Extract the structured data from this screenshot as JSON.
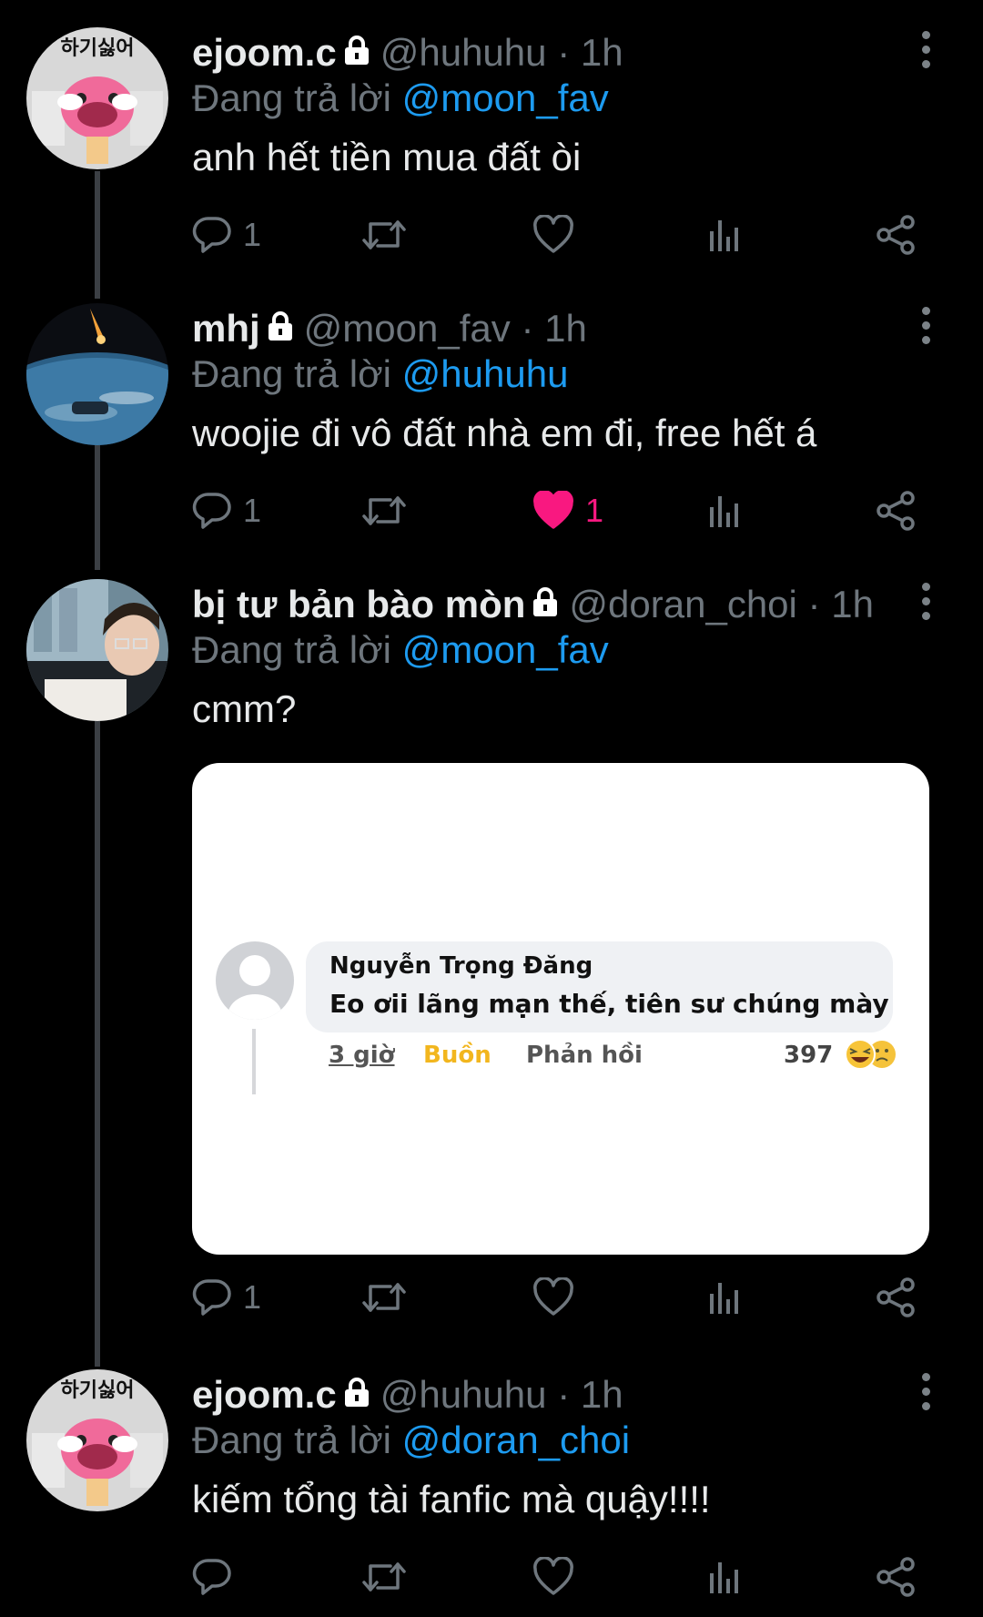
{
  "tweets": [
    {
      "display_name": "ejoom.c",
      "handle": "@huhuhu",
      "separator": "·",
      "time": "1h",
      "reply_prefix": "Đang trả lời",
      "reply_to": "@moon_fav",
      "text": "anh hết tiền mua đất òi",
      "avatar_text": "하기싫어",
      "counts": {
        "reply": "1",
        "retweet": "",
        "like": ""
      },
      "liked": false
    },
    {
      "display_name": "mhj",
      "handle": "@moon_fav",
      "separator": "·",
      "time": "1h",
      "reply_prefix": "Đang trả lời",
      "reply_to": "@huhuhu",
      "text": "woojie đi vô đất nhà em đi, free hết á",
      "avatar_text": "",
      "counts": {
        "reply": "1",
        "retweet": "",
        "like": "1"
      },
      "liked": true
    },
    {
      "display_name": "bị tư bản bào mòn",
      "handle": "@doran_choi",
      "separator": "·",
      "time": "1h",
      "reply_prefix": "Đang trả lời",
      "reply_to": "@moon_fav",
      "text": "cmm?",
      "avatar_text": "",
      "counts": {
        "reply": "1",
        "retweet": "",
        "like": ""
      },
      "liked": false,
      "media": {
        "commenter_name": "Nguyễn Trọng Đăng",
        "comment_text": "Eo ơii lãng mạn thế, tiên sư chúng mày",
        "comment_time": "3 giờ",
        "reaction_label": "Buồn",
        "reply_label": "Phản hồi",
        "reaction_count": "397"
      }
    },
    {
      "display_name": "ejoom.c",
      "handle": "@huhuhu",
      "separator": "·",
      "time": "1h",
      "reply_prefix": "Đang trả lời",
      "reply_to": "@doran_choi",
      "text": "kiếm tổng tài fanfic mà quậy!!!!",
      "avatar_text": "하기싫어",
      "counts": {
        "reply": "",
        "retweet": "",
        "like": ""
      },
      "liked": false
    }
  ],
  "icons": {
    "reply": "reply-bubble-icon",
    "retweet": "retweet-icon",
    "like": "heart-icon",
    "analytics": "analytics-bars-icon",
    "share": "share-icon",
    "lock": "lock-icon",
    "more": "more-vertical-icon"
  },
  "colors": {
    "background": "#000000",
    "text": "#e7e9ea",
    "muted": "#6e767d",
    "mention": "#1d9bf0",
    "like_active": "#f91880"
  }
}
